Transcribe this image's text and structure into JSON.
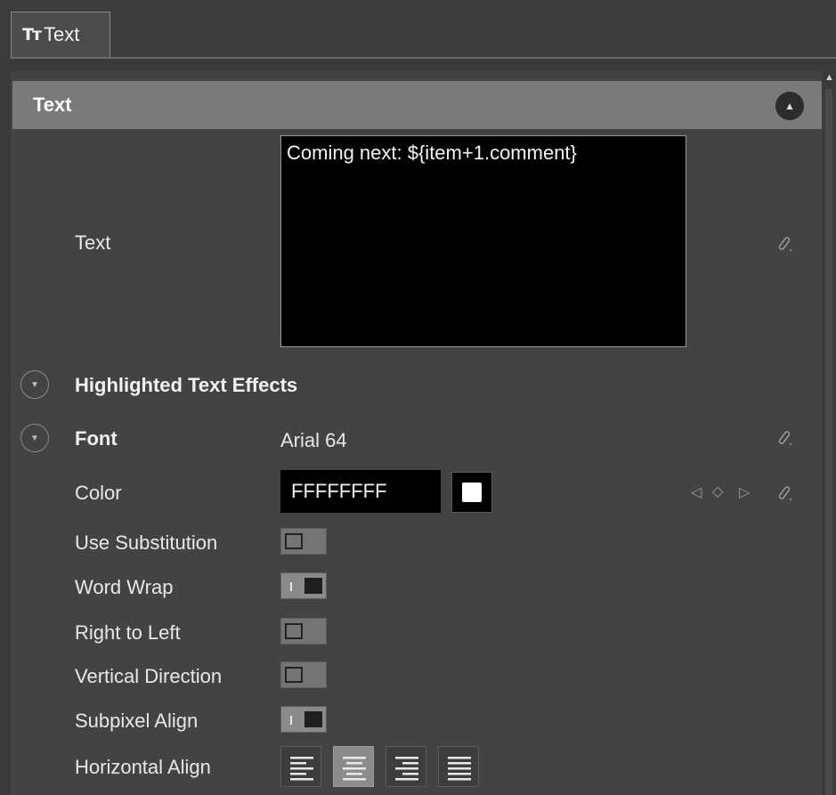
{
  "tab": {
    "icon": "text-icon",
    "icon_glyph": "Tт",
    "label": "Text"
  },
  "section": {
    "title": "Text",
    "collapse_icon": "chevron-up-icon"
  },
  "text_property": {
    "label": "Text",
    "value": "Coming next: ${item+1.comment}"
  },
  "highlighted_effects": {
    "label": "Highlighted Text Effects",
    "expand_icon": "chevron-down-icon"
  },
  "font": {
    "label": "Font",
    "value": "Arial 64"
  },
  "color": {
    "label": "Color",
    "value": "FFFFFFFF",
    "swatch": "#FFFFFF"
  },
  "toggles": [
    {
      "label": "Use Substitution",
      "on": false
    },
    {
      "label": "Word Wrap",
      "on": true
    },
    {
      "label": "Right to Left",
      "on": false
    },
    {
      "label": "Vertical Direction",
      "on": false
    },
    {
      "label": "Subpixel Align",
      "on": true
    }
  ],
  "horizontal_align": {
    "label": "Horizontal Align",
    "options": [
      "align-left-icon",
      "align-center-icon",
      "align-right-icon",
      "align-justify-icon"
    ],
    "selected": "align-center-icon"
  },
  "colors": {
    "background": "#3a3a3a",
    "panel": "#434343",
    "header": "#7a7a7a",
    "field": "#000000"
  }
}
